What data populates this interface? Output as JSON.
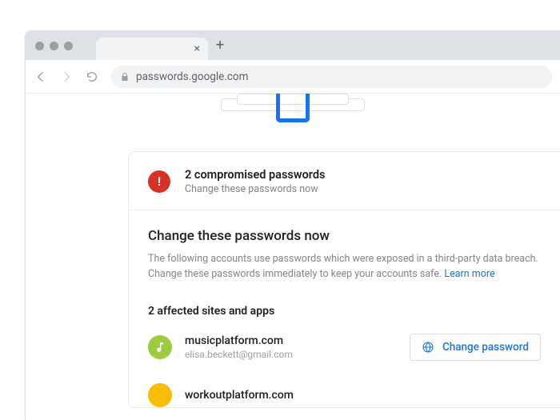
{
  "browser": {
    "url": "passwords.google.com",
    "new_tab_label": "+"
  },
  "alert": {
    "title": "2 compromised passwords",
    "subtitle": "Change these passwords now"
  },
  "section": {
    "heading": "Change these passwords now",
    "description": "The following accounts use passwords which were exposed in a third-party data breach. Change these passwords immediately to keep your accounts safe. ",
    "learn_more": "Learn more"
  },
  "affected": {
    "heading": "2 affected sites and apps",
    "change_label": "Change password",
    "sites": [
      {
        "name": "musicplatform.com",
        "email": "elisa.beckett@gmail.com",
        "icon": "music-note-icon",
        "icon_bg": "#9ccc3c"
      },
      {
        "name": "workoutplatform.com",
        "email": "",
        "icon": "circle-icon",
        "icon_bg": "#fbbc04"
      }
    ]
  }
}
